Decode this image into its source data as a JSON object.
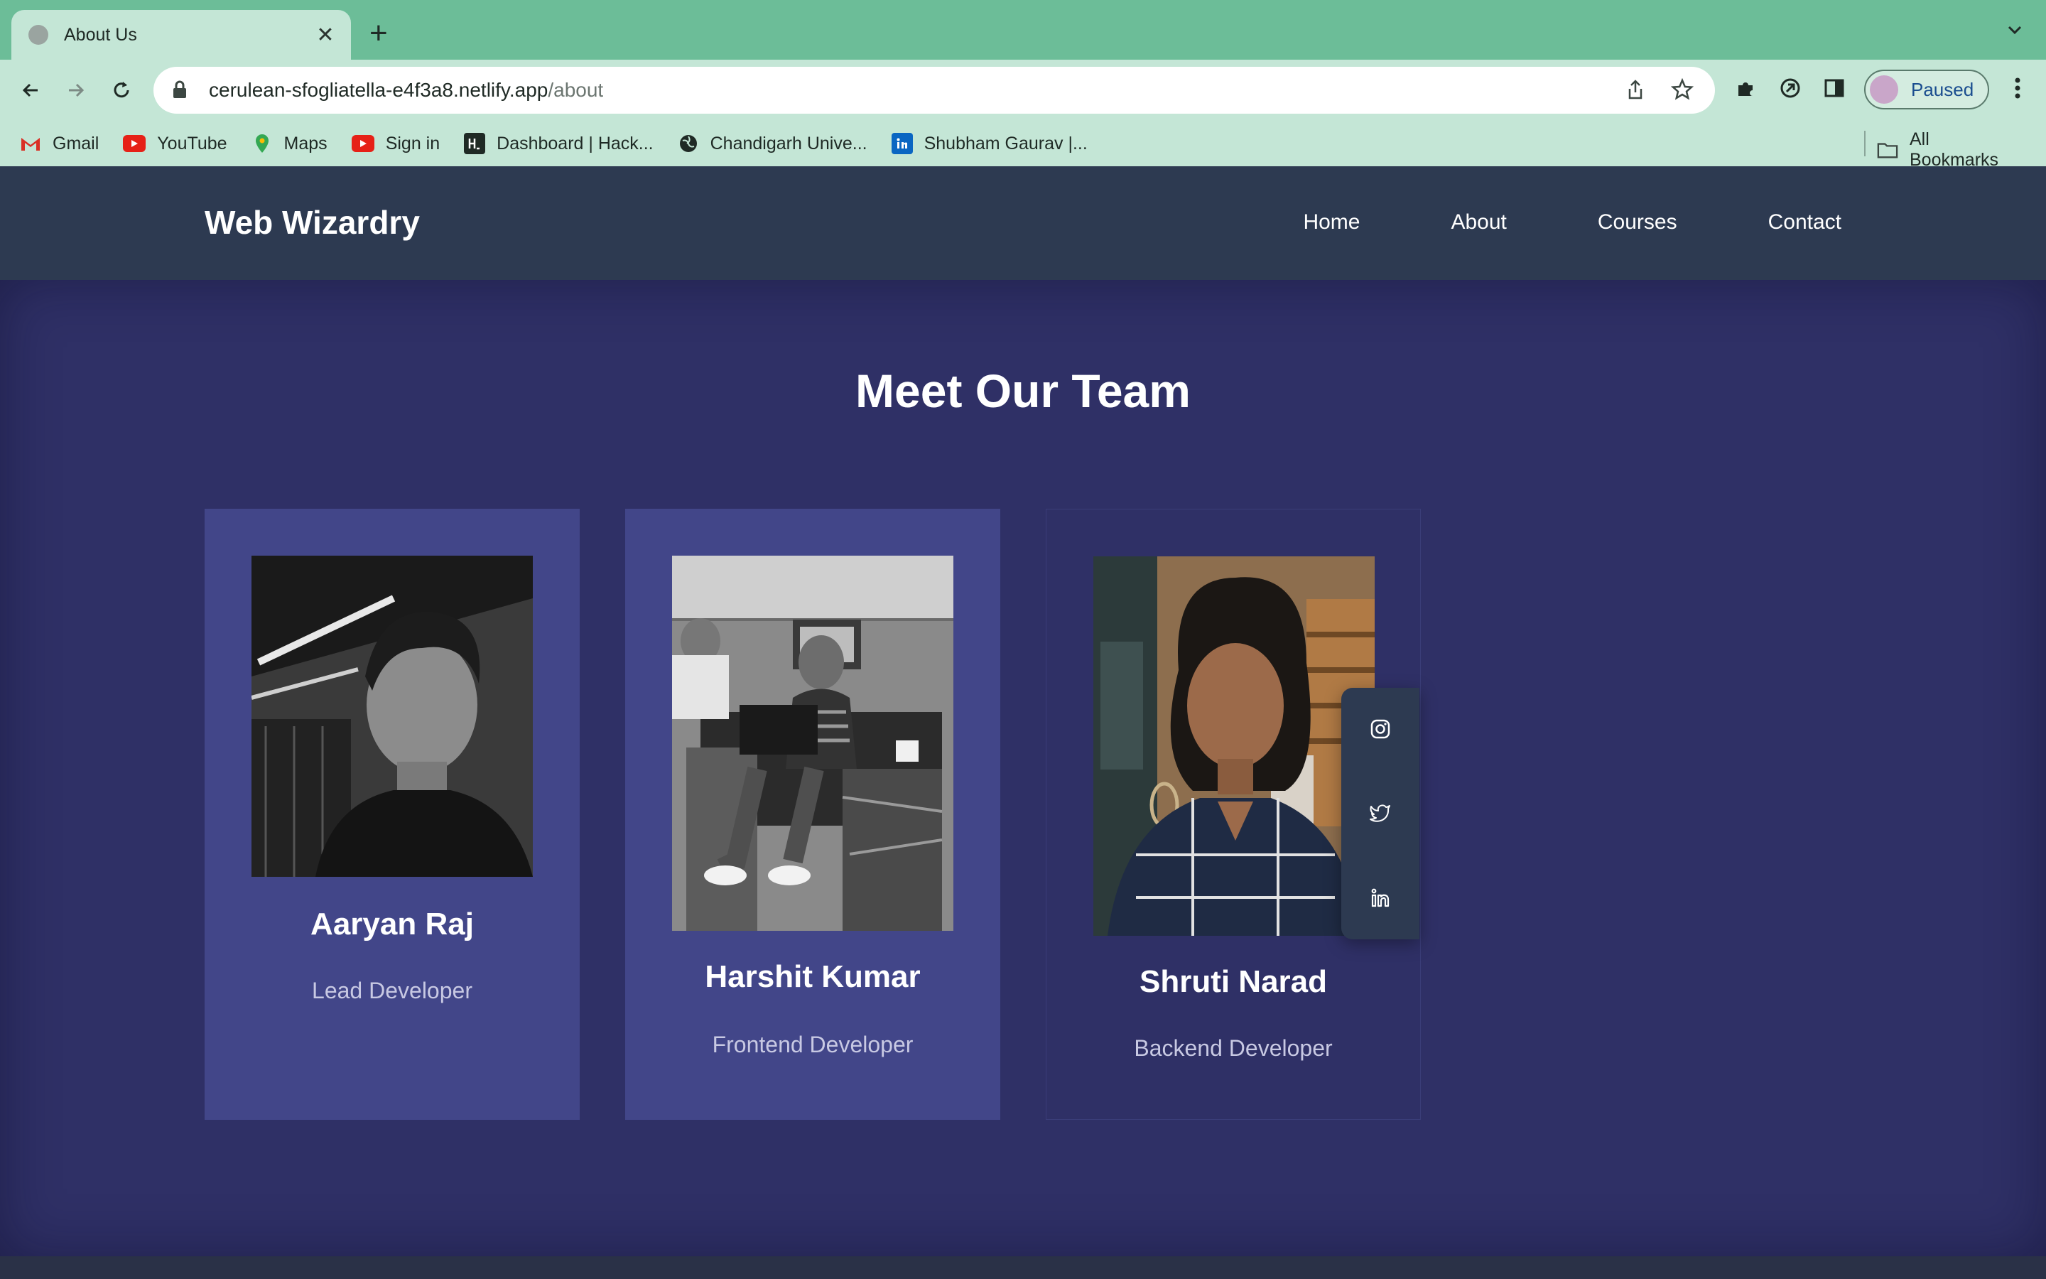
{
  "browser": {
    "tab_title": "About Us",
    "tab_close": "✕",
    "new_tab": "+",
    "url_host": "cerulean-sfogliatella-e4f3a8.netlify.app",
    "url_path": "/about",
    "profile_label": "Paused",
    "bookmarks": [
      {
        "label": "Gmail",
        "icon": "gmail-icon",
        "color": "#d93025"
      },
      {
        "label": "YouTube",
        "icon": "youtube-icon",
        "color": "#e62117"
      },
      {
        "label": "Maps",
        "icon": "maps-icon",
        "color": "#34a853"
      },
      {
        "label": "Sign in",
        "icon": "youtube-icon",
        "color": "#e62117"
      },
      {
        "label": "Dashboard | Hack...",
        "icon": "hackerrank-icon",
        "color": "#1f2a25"
      },
      {
        "label": "Chandigarh Unive...",
        "icon": "globe-icon",
        "color": "#1f2a25"
      },
      {
        "label": "Shubham Gaurav |...",
        "icon": "linkedin-icon",
        "color": "#0a66c2"
      }
    ],
    "all_bookmarks": "All Bookmarks"
  },
  "site": {
    "brand": "Web Wizardry",
    "nav": [
      "Home",
      "About",
      "Courses",
      "Contact"
    ]
  },
  "main": {
    "heading": "Meet Our Team",
    "team": [
      {
        "name": "Aaryan Raj",
        "role": "Lead Developer"
      },
      {
        "name": "Harshit Kumar",
        "role": "Frontend Developer"
      },
      {
        "name": "Shruti Narad",
        "role": "Backend Developer"
      }
    ],
    "social_icons": [
      "instagram-icon",
      "twitter-icon",
      "linkedin-icon"
    ]
  },
  "colors": {
    "header_bg": "#2d3a51",
    "main_bg": "#2f3066",
    "card_bg": "#424689",
    "tabstrip_bg": "#6cbd98"
  }
}
